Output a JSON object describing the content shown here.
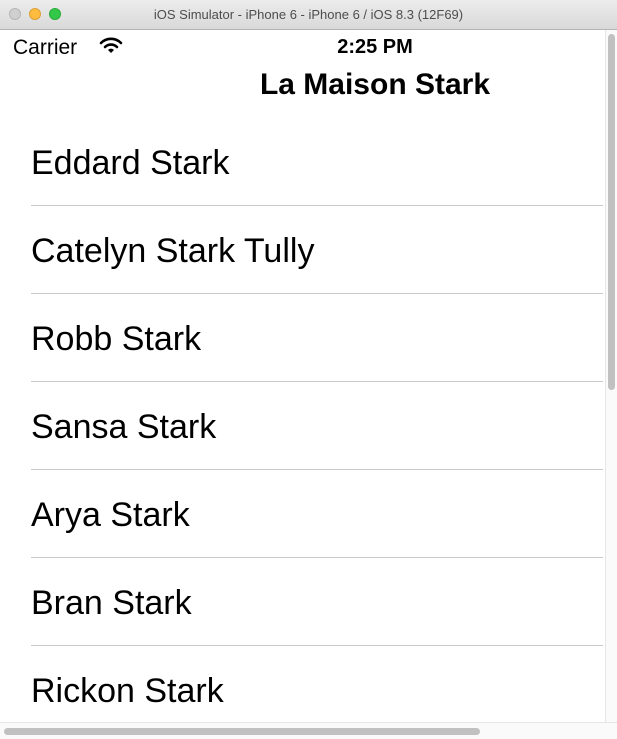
{
  "window": {
    "title": "iOS Simulator - iPhone 6 - iPhone 6 / iOS 8.3 (12F69)"
  },
  "status_bar": {
    "carrier": "Carrier",
    "wifi_icon": "wifi-icon",
    "time": "2:25 PM"
  },
  "nav": {
    "title": "La Maison Stark"
  },
  "list": {
    "items": [
      {
        "label": "Eddard Stark"
      },
      {
        "label": "Catelyn Stark Tully"
      },
      {
        "label": "Robb Stark"
      },
      {
        "label": "Sansa Stark"
      },
      {
        "label": "Arya Stark"
      },
      {
        "label": "Bran Stark"
      },
      {
        "label": "Rickon Stark"
      }
    ]
  },
  "colors": {
    "separator": "#c8c7cc",
    "traffic_close": "#d0d0d0",
    "traffic_minimize": "#fdbc40",
    "traffic_maximize": "#34c84a"
  }
}
